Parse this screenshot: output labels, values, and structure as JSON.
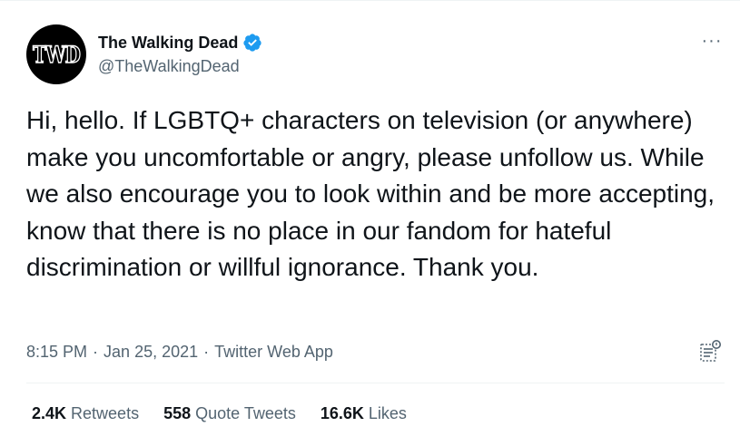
{
  "account": {
    "avatar_text": "TWD",
    "display_name": "The Walking Dead",
    "handle": "@TheWalkingDead",
    "verified_icon": "verified-badge-icon",
    "verified_color": "#1d9bf0"
  },
  "menu": {
    "more_glyph": "···"
  },
  "tweet": {
    "text": "Hi, hello. If LGBTQ+ characters on television (or anywhere) make you uncomfortable or angry, please unfollow us. While we also encourage you to look within and be more accepting, know that there is no place in our fandom for hateful discrimination or willful ignorance. Thank you.",
    "time": "8:15 PM",
    "date": "Jan 25, 2021",
    "separator": "·",
    "source": "Twitter Web App"
  },
  "stats": [
    {
      "count": "2.4K",
      "label": "Retweets"
    },
    {
      "count": "558",
      "label": "Quote Tweets"
    },
    {
      "count": "16.6K",
      "label": "Likes"
    }
  ],
  "colors": {
    "text": "#0f1419",
    "secondary": "#536471",
    "border": "#eff3f4",
    "avatar_bg": "#000000"
  }
}
